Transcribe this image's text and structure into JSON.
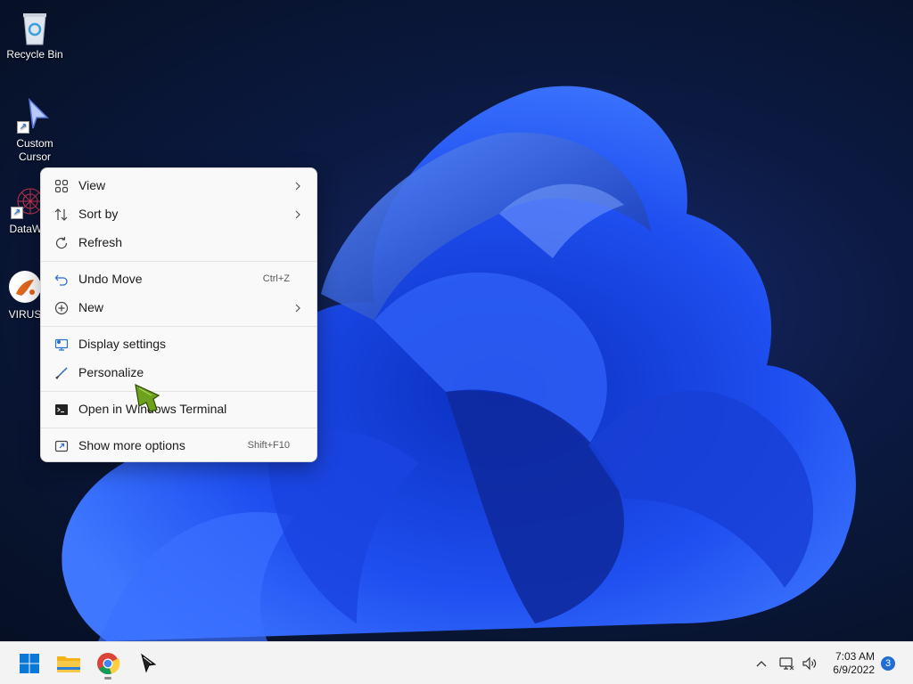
{
  "desktop": {
    "icons": [
      {
        "label": "Recycle Bin",
        "icon": "recycle-bin-icon"
      },
      {
        "label": "Custom Cursor",
        "icon": "custom-cursor-icon"
      },
      {
        "label": "DataWa",
        "icon": "datawa-icon"
      },
      {
        "label": "VIRUS",
        "icon": "virus-app-icon"
      }
    ]
  },
  "context_menu": {
    "items": [
      {
        "label": "View",
        "icon": "grid-icon",
        "submenu": true
      },
      {
        "label": "Sort by",
        "icon": "sort-icon",
        "submenu": true
      },
      {
        "label": "Refresh",
        "icon": "refresh-icon"
      },
      {
        "label": "Undo Move",
        "icon": "undo-icon",
        "shortcut": "Ctrl+Z"
      },
      {
        "label": "New",
        "icon": "plus-circle-icon",
        "submenu": true
      },
      {
        "label": "Display settings",
        "icon": "display-icon"
      },
      {
        "label": "Personalize",
        "icon": "brush-icon"
      },
      {
        "label": "Open in Windows Terminal",
        "icon": "terminal-icon"
      },
      {
        "label": "Show more options",
        "icon": "share-icon",
        "shortcut": "Shift+F10"
      }
    ]
  },
  "taskbar": {
    "apps": [
      {
        "name": "start-button",
        "icon": "windows-logo-icon"
      },
      {
        "name": "file-explorer",
        "icon": "folder-icon"
      },
      {
        "name": "chrome",
        "icon": "chrome-icon"
      },
      {
        "name": "custom-cursor-app",
        "icon": "cursor-icon"
      }
    ],
    "clock": {
      "time": "7:03 AM",
      "date": "6/9/2022"
    },
    "notifications_count": "3"
  },
  "colors": {
    "accent": "#1f6ed4",
    "wallpaper_dark": "#081430",
    "wallpaper_blue": "#1d4ee8"
  }
}
